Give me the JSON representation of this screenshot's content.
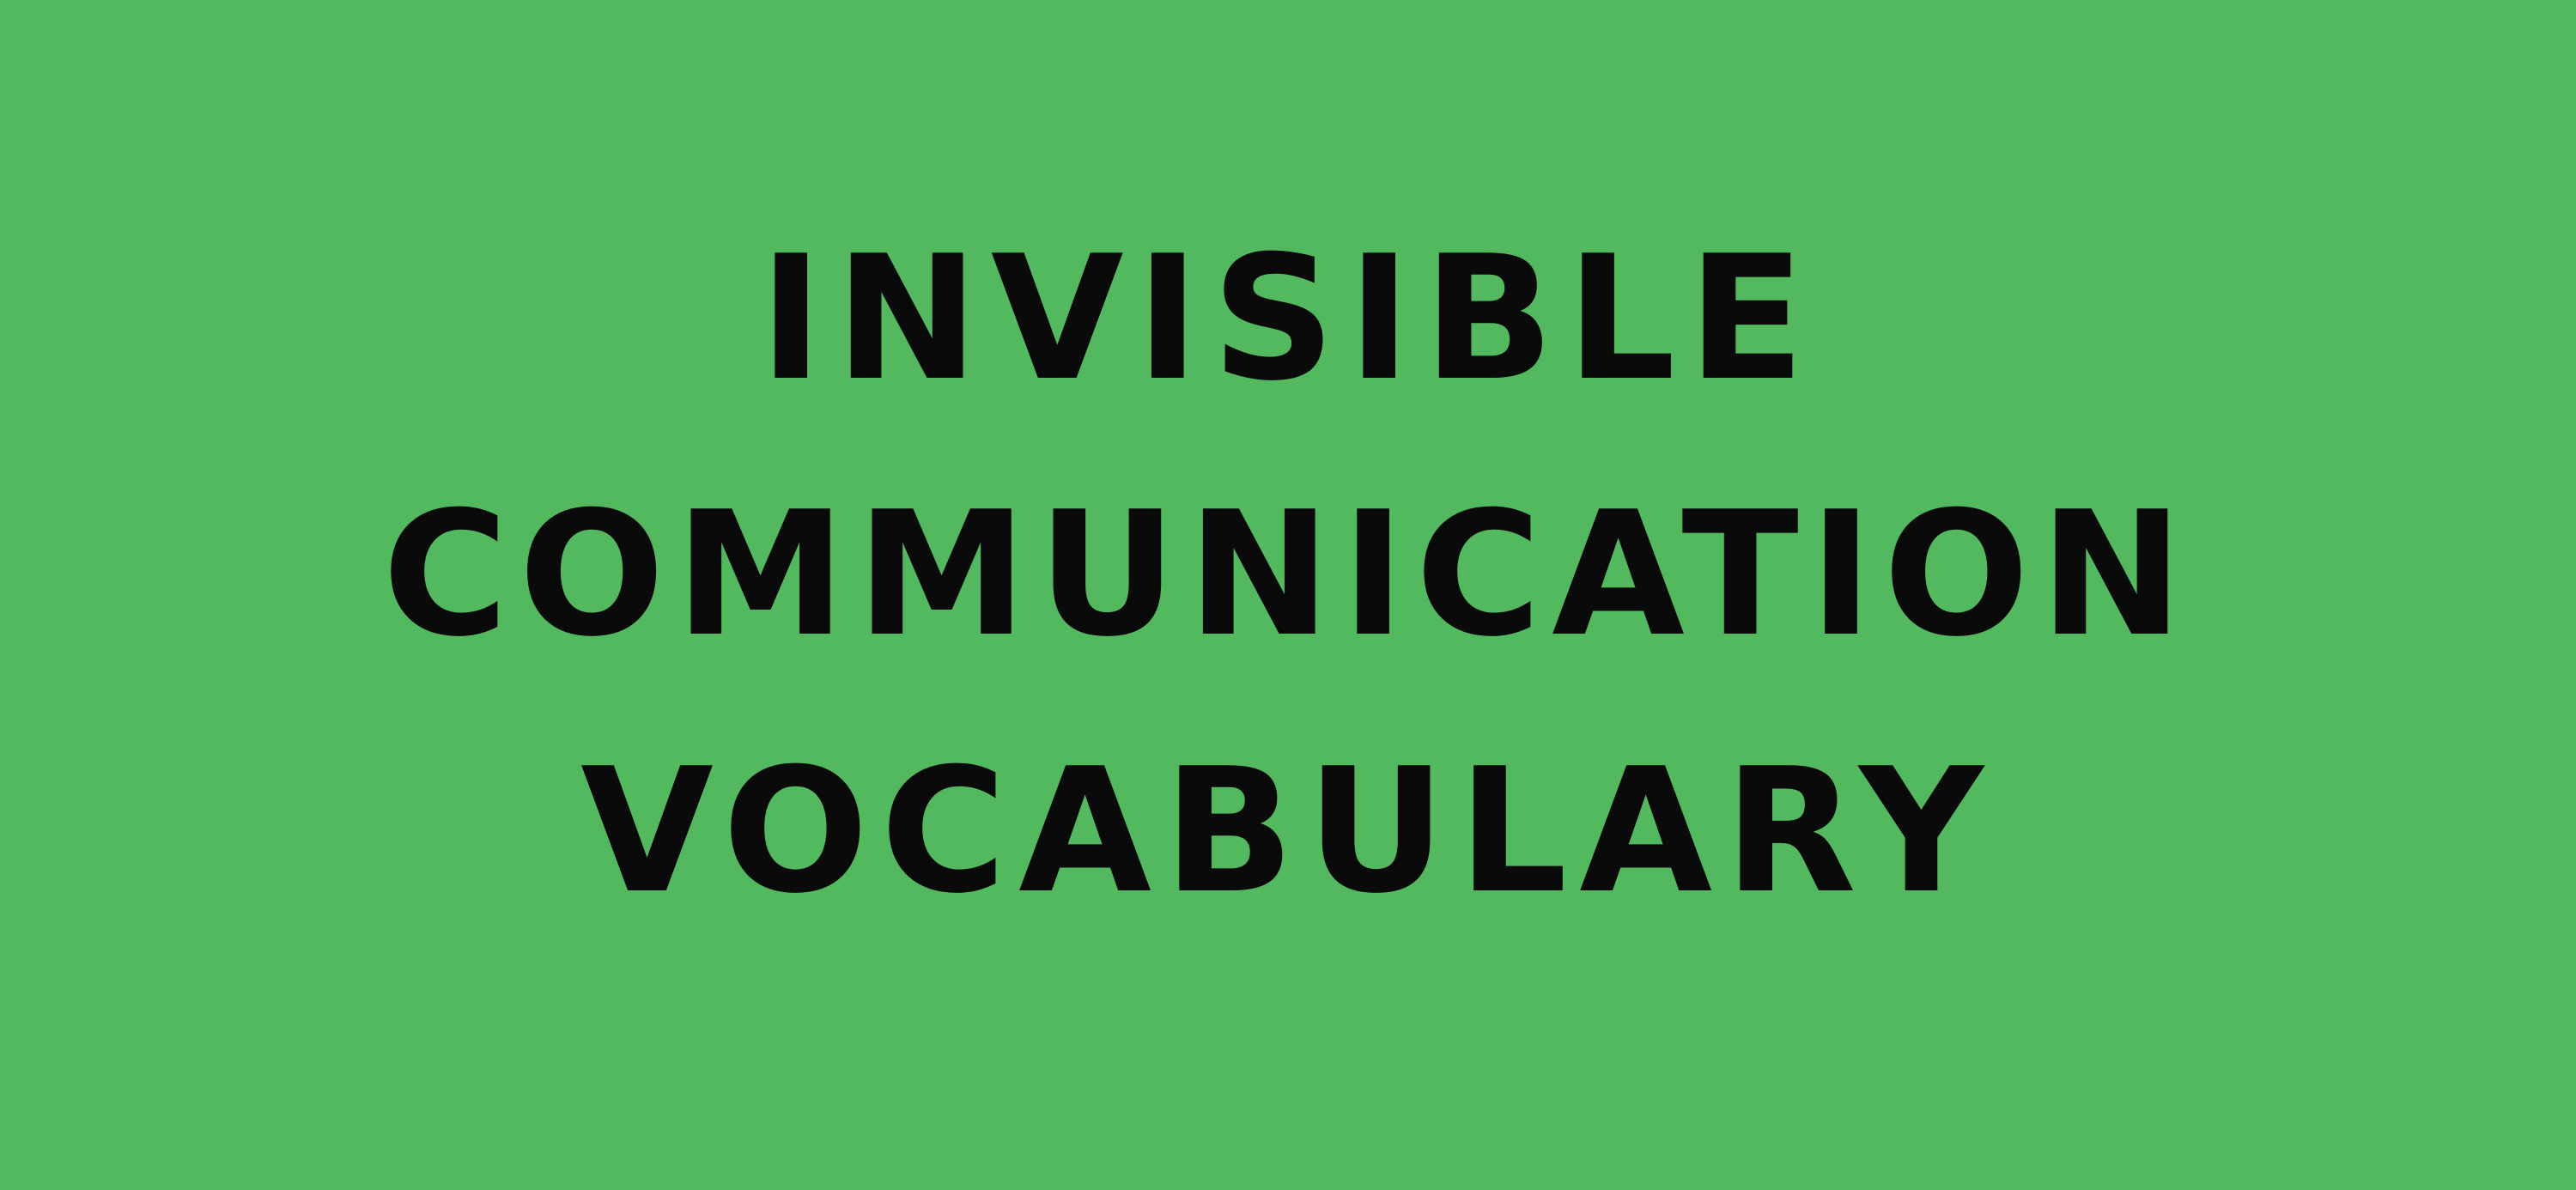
{
  "background_color": "#52b95e",
  "text_color": "#0a0a0a",
  "title": {
    "line1": "INVISIBLE",
    "line2": "COMMUNICATION",
    "line3": "VOCABULARY"
  }
}
